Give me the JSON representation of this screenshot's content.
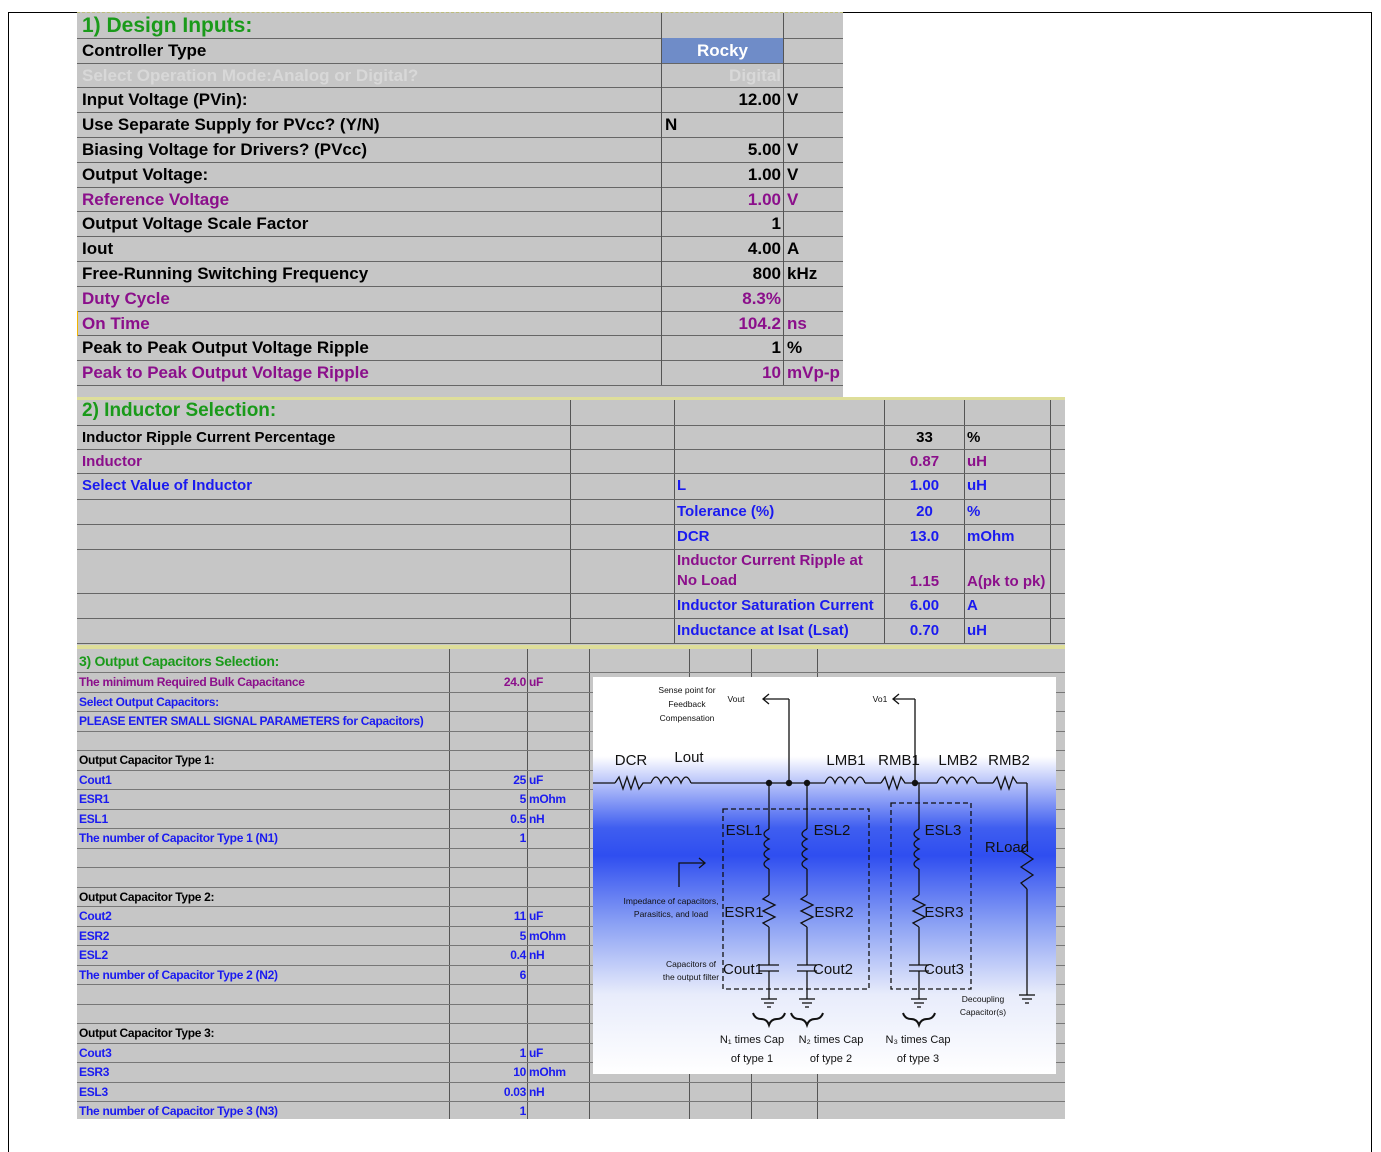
{
  "section1": {
    "title": "1) Design Inputs:",
    "rows": [
      {
        "label": "Controller Type",
        "value": "Rocky",
        "unit": ""
      },
      {
        "label": "Select Operation Mode:Analog or Digital?",
        "value": "Digital",
        "unit": ""
      },
      {
        "label": "Input Voltage (PVin):",
        "value": "12.00",
        "unit": "V"
      },
      {
        "label": "Use Separate Supply for PVcc? (Y/N)",
        "value": "N",
        "unit": ""
      },
      {
        "label": "Biasing Voltage for Drivers? (PVcc)",
        "value": "5.00",
        "unit": "V"
      },
      {
        "label": "Output Voltage:",
        "value": "1.00",
        "unit": "V"
      },
      {
        "label": "Reference Voltage",
        "value": "1.00",
        "unit": "V"
      },
      {
        "label": "Output Voltage Scale Factor",
        "value": "1",
        "unit": ""
      },
      {
        "label": "Iout",
        "value": "4.00",
        "unit": "A"
      },
      {
        "label": "Free-Running Switching Frequency",
        "value": "800",
        "unit": "kHz"
      },
      {
        "label": "Duty Cycle",
        "value": "8.3%",
        "unit": ""
      },
      {
        "label": "On Time",
        "value": "104.2",
        "unit": "ns"
      },
      {
        "label": "Peak to Peak Output Voltage Ripple",
        "value": "1",
        "unit": "%"
      },
      {
        "label": "Peak to Peak Output Voltage Ripple",
        "value": "10",
        "unit": "mVp-p"
      }
    ]
  },
  "section2": {
    "title": "2) Inductor Selection:",
    "rows": [
      {
        "label": "Inductor Ripple Current Percentage",
        "param": "",
        "value": "33",
        "unit": "%"
      },
      {
        "label": "Inductor",
        "param": "",
        "value": "0.87",
        "unit": "uH"
      },
      {
        "label": "Select Value of Inductor",
        "param": "L",
        "value": "1.00",
        "unit": "uH"
      },
      {
        "label": "",
        "param": "Tolerance (%)",
        "value": "20",
        "unit": "%"
      },
      {
        "label": "",
        "param": "DCR",
        "value": "13.0",
        "unit": "mOhm"
      },
      {
        "label": "",
        "param": "Inductor Current Ripple at",
        "param2": "No Load",
        "value": "1.15",
        "unit": "A(pk to pk)"
      },
      {
        "label": "",
        "param": "Inductor Saturation Current",
        "value": "6.00",
        "unit": "A"
      },
      {
        "label": "",
        "param": "Inductance at Isat (Lsat)",
        "value": "0.70",
        "unit": "uH"
      }
    ]
  },
  "section3": {
    "title": "3) Output Capacitors Selection:",
    "rows": [
      {
        "label": "The minimum Required Bulk Capacitance",
        "value": "24.0",
        "unit": "uF",
        "style": "pur"
      },
      {
        "label": "Select Output Capacitors:",
        "value": "",
        "unit": "",
        "style": "blu"
      },
      {
        "label": "PLEASE ENTER SMALL SIGNAL PARAMETERS for Capacitors)",
        "value": "",
        "unit": "",
        "style": "blu"
      },
      {
        "label": "",
        "value": "",
        "unit": "",
        "style": "blk"
      },
      {
        "label": "Output Capacitor Type 1:",
        "value": "",
        "unit": "",
        "style": "blk"
      },
      {
        "label": "Cout1",
        "value": "25",
        "unit": "uF",
        "style": "blu"
      },
      {
        "label": "ESR1",
        "value": "5",
        "unit": "mOhm",
        "style": "blu"
      },
      {
        "label": "ESL1",
        "value": "0.5",
        "unit": "nH",
        "style": "blu"
      },
      {
        "label": "The number of Capacitor Type 1 (N1)",
        "value": "1",
        "unit": "",
        "style": "blu"
      },
      {
        "label": "",
        "value": "",
        "unit": "",
        "style": "blk"
      },
      {
        "label": "",
        "value": "",
        "unit": "",
        "style": "blk"
      },
      {
        "label": "Output Capacitor Type 2:",
        "value": "",
        "unit": "",
        "style": "blk"
      },
      {
        "label": "Cout2",
        "value": "11",
        "unit": "uF",
        "style": "blu"
      },
      {
        "label": "ESR2",
        "value": "5",
        "unit": "mOhm",
        "style": "blu"
      },
      {
        "label": "ESL2",
        "value": "0.4",
        "unit": "nH",
        "style": "blu"
      },
      {
        "label": "The number of Capacitor Type 2 (N2)",
        "value": "6",
        "unit": "",
        "style": "blu"
      },
      {
        "label": "",
        "value": "",
        "unit": "",
        "style": "blk"
      },
      {
        "label": "",
        "value": "",
        "unit": "",
        "style": "blk"
      },
      {
        "label": "Output Capacitor Type 3:",
        "value": "",
        "unit": "",
        "style": "blk"
      },
      {
        "label": "Cout3",
        "value": "1",
        "unit": "uF",
        "style": "blu"
      },
      {
        "label": "ESR3",
        "value": "10",
        "unit": "mOhm",
        "style": "blu"
      },
      {
        "label": "ESL3",
        "value": "0.03",
        "unit": "nH",
        "style": "blu"
      },
      {
        "label": "The number of Capacitor Type 3 (N3)",
        "value": "1",
        "unit": "",
        "style": "blu"
      }
    ]
  },
  "figure": {
    "sense_note": [
      "Sense point for",
      "Feedback",
      "Compensation"
    ],
    "vout": "Vout",
    "vo1": "Vo1",
    "dcr": "DCR",
    "lout": "Lout",
    "lmb1": "LMB1",
    "rmb1": "RMB1",
    "lmb2": "LMB2",
    "rmb2": "RMB2",
    "esl1": "ESL1",
    "esl2": "ESL2",
    "esl3": "ESL3",
    "esr1": "ESR1",
    "esr2": "ESR2",
    "esr3": "ESR3",
    "cout1": "Cout1",
    "cout2": "Cout2",
    "cout3": "Cout3",
    "rload": "RLoad",
    "impedance_note": [
      "Impedance of capacitors,",
      "Parasitics, and load"
    ],
    "caps_note": [
      "Capacitors of",
      "the output filter"
    ],
    "decoupling_note": [
      "Decoupling",
      "Capacitor(s)"
    ],
    "n1": [
      "N₁ times Cap",
      "of type 1"
    ],
    "n2": [
      "N₂ times Cap",
      "of type 2"
    ],
    "n3": [
      "N₃ times Cap",
      "of type 3"
    ]
  }
}
